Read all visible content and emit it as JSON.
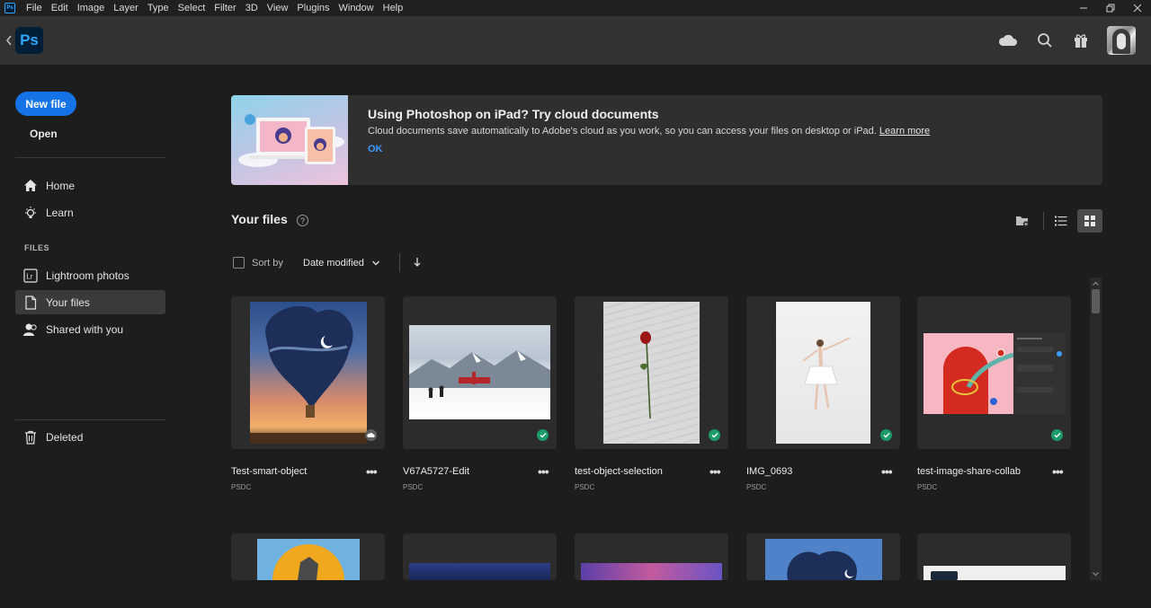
{
  "menu": {
    "app_badge": "Ps",
    "items": [
      "File",
      "Edit",
      "Image",
      "Layer",
      "Type",
      "Select",
      "Filter",
      "3D",
      "View",
      "Plugins",
      "Window",
      "Help"
    ]
  },
  "topbar": {
    "logo": "Ps",
    "icons": [
      "cloud-icon",
      "search-icon",
      "gift-icon"
    ]
  },
  "sidebar": {
    "new_file": "New file",
    "open": "Open",
    "home": "Home",
    "learn": "Learn",
    "section_files": "FILES",
    "lightroom": "Lightroom photos",
    "your_files": "Your files",
    "shared": "Shared with you",
    "deleted": "Deleted",
    "lr_badge": "Lr"
  },
  "banner": {
    "title": "Using Photoshop on iPad? Try cloud documents",
    "body": "Cloud documents save automatically to Adobe's cloud as you work, so you can access your files on desktop or iPad.",
    "learn_more": "Learn more",
    "ok": "OK"
  },
  "files": {
    "title": "Your files",
    "help": "?",
    "sort_by_label": "Sort by",
    "sort_value": "Date modified"
  },
  "cards": [
    {
      "name": "Test-smart-object",
      "type": "PSDC",
      "status": "cloud"
    },
    {
      "name": "V67A5727-Edit",
      "type": "PSDC",
      "status": "synced"
    },
    {
      "name": "test-object-selection",
      "type": "PSDC",
      "status": "synced"
    },
    {
      "name": "IMG_0693",
      "type": "PSDC",
      "status": "synced"
    },
    {
      "name": "test-image-share-collab",
      "type": "PSDC",
      "status": "synced"
    }
  ],
  "colors": {
    "accent": "#1473e6",
    "link": "#3b9cff",
    "synced": "#1c9a6a",
    "ps_blue": "#31a8ff"
  }
}
